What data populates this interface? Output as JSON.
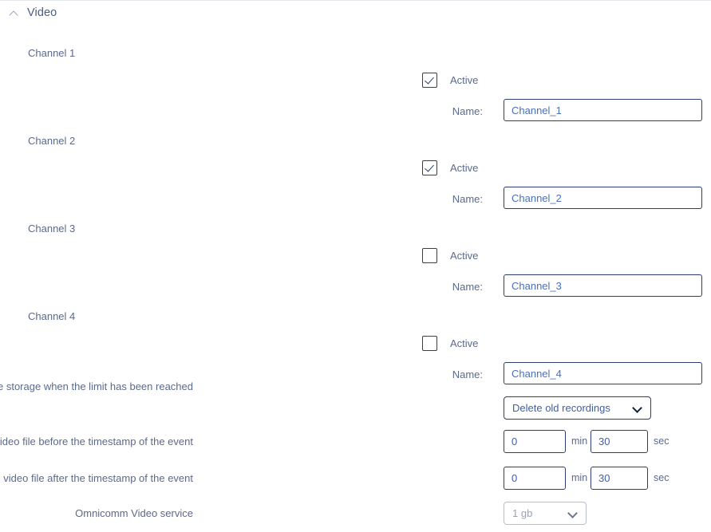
{
  "section": {
    "title": "Video",
    "collapse_icon": "chevron-up-icon",
    "expanded": true
  },
  "channels": [
    {
      "group_label": "Channel 1",
      "active_label": "Active",
      "active": true,
      "name_label": "Name:",
      "name_value": "Channel_1"
    },
    {
      "group_label": "Channel 2",
      "active_label": "Active",
      "active": true,
      "name_label": "Name:",
      "name_value": "Channel_2"
    },
    {
      "group_label": "Channel 3",
      "active_label": "Active",
      "active": false,
      "name_label": "Name:",
      "name_value": "Channel_3"
    },
    {
      "group_label": "Channel 4",
      "active_label": "Active",
      "active": false,
      "name_label": "Name:",
      "name_value": "Channel_4"
    }
  ],
  "settings": {
    "storage": {
      "label": "Video file storage when the limit has been reached",
      "value": "Delete old recordings",
      "caret_icon": "chevron-down-icon",
      "disabled": false
    },
    "duration_before": {
      "label": "Duration of the video file before the timestamp of the event",
      "minutes": "0",
      "minutes_unit": "min",
      "seconds": "30",
      "seconds_unit": "sec"
    },
    "duration_after": {
      "label": "Duration of the video file after the timestamp of the event",
      "minutes": "0",
      "minutes_unit": "min",
      "seconds": "30",
      "seconds_unit": "sec"
    },
    "video_service": {
      "label": "Omnicomm Video service",
      "value": "1 gb",
      "caret_icon": "chevron-down-icon",
      "disabled": true
    }
  },
  "colors": {
    "text": "#5b6a8c",
    "input_border": "#2c3e6b",
    "input_text": "#3f5fa8",
    "disabled_border": "#b9bfcf",
    "disabled_text": "#9aa2b5",
    "rule": "#e6e8ef"
  }
}
